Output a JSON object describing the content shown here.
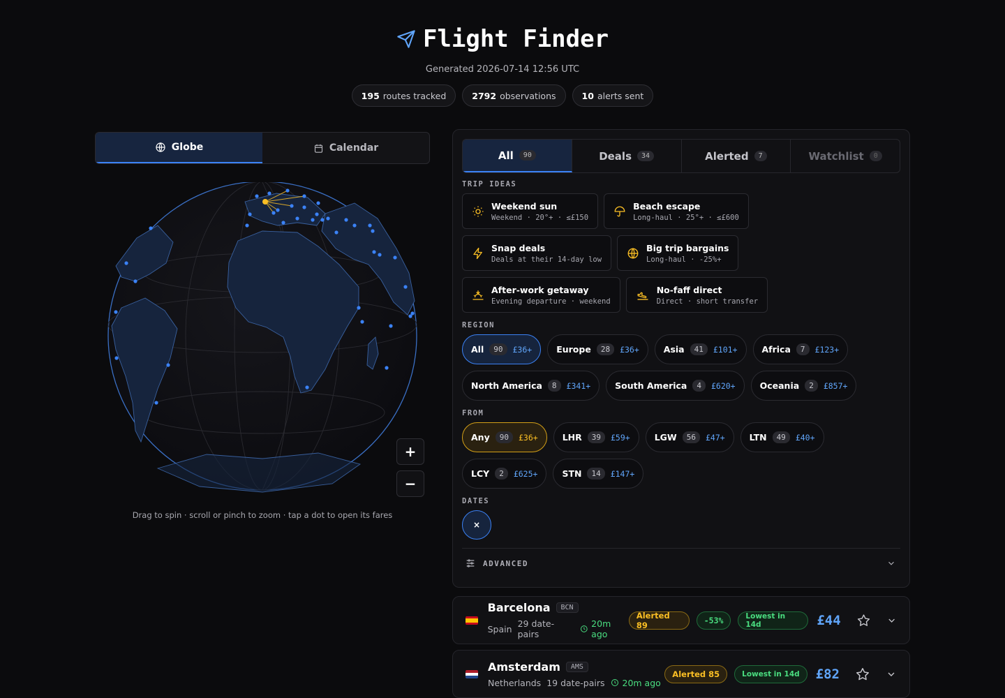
{
  "header": {
    "title": "Flight Finder",
    "generated": "Generated 2026-07-14 12:56 UTC",
    "stats": [
      {
        "value": "195",
        "label": "routes tracked"
      },
      {
        "value": "2792",
        "label": "observations"
      },
      {
        "value": "10",
        "label": "alerts sent"
      }
    ]
  },
  "left": {
    "tabs": [
      {
        "label": "Globe",
        "icon": "globe-icon"
      },
      {
        "label": "Calendar",
        "icon": "calendar-icon"
      }
    ],
    "zoom_in": "+",
    "zoom_out": "−",
    "hint": "Drag to spin · scroll or pinch to zoom · tap a dot to open its fares"
  },
  "filters": {
    "tabs": [
      {
        "label": "All",
        "count": "90"
      },
      {
        "label": "Deals",
        "count": "34"
      },
      {
        "label": "Alerted",
        "count": "7"
      },
      {
        "label": "Watchlist",
        "count": "0"
      }
    ],
    "trip_ideas_label": "TRIP IDEAS",
    "trip_ideas": [
      {
        "title": "Weekend sun",
        "sub": "Weekend · 20°+ · ≤£150",
        "icon": "sun-icon"
      },
      {
        "title": "Beach escape",
        "sub": "Long-haul · 25°+ · ≤£600",
        "icon": "umbrella-icon"
      },
      {
        "title": "Snap deals",
        "sub": "Deals at their 14-day low",
        "icon": "lightning-icon"
      },
      {
        "title": "Big trip bargains",
        "sub": "Long-haul · -25%+",
        "icon": "globe-icon"
      },
      {
        "title": "After-work getaway",
        "sub": "Evening departure · weekend",
        "icon": "sunset-icon"
      },
      {
        "title": "No-faff direct",
        "sub": "Direct · short transfer",
        "icon": "plane-landing-icon"
      }
    ],
    "region_label": "REGION",
    "regions": [
      {
        "name": "All",
        "count": "90",
        "price": "£36+"
      },
      {
        "name": "Europe",
        "count": "28",
        "price": "£36+"
      },
      {
        "name": "Asia",
        "count": "41",
        "price": "£101+"
      },
      {
        "name": "Africa",
        "count": "7",
        "price": "£123+"
      },
      {
        "name": "North America",
        "count": "8",
        "price": "£341+"
      },
      {
        "name": "South America",
        "count": "4",
        "price": "£620+"
      },
      {
        "name": "Oceania",
        "count": "2",
        "price": "£857+"
      }
    ],
    "from_label": "FROM",
    "airports": [
      {
        "name": "Any",
        "count": "90",
        "price": "£36+"
      },
      {
        "name": "LHR",
        "count": "39",
        "price": "£59+"
      },
      {
        "name": "LGW",
        "count": "56",
        "price": "£47+"
      },
      {
        "name": "LTN",
        "count": "49",
        "price": "£40+"
      },
      {
        "name": "LCY",
        "count": "2",
        "price": "£625+"
      },
      {
        "name": "STN",
        "count": "14",
        "price": "£147+"
      }
    ],
    "dates_label": "DATES",
    "dates_clear": "×",
    "advanced_label": "ADVANCED"
  },
  "results": [
    {
      "city": "Barcelona",
      "code": "BCN",
      "country": "Spain",
      "pairs": "29 date-pairs",
      "ago": "20m ago",
      "alerted": "Alerted 89",
      "pct": "-53%",
      "lowest": "Lowest in 14d",
      "price": "£44"
    },
    {
      "city": "Amsterdam",
      "code": "AMS",
      "country": "Netherlands",
      "pairs": "19 date-pairs",
      "ago": "20m ago",
      "alerted": "Alerted 85",
      "pct": "",
      "lowest": "Lowest in 14d",
      "price": "£82"
    }
  ],
  "colors": {
    "accent": "#3b82f6",
    "amber": "#fbbf24",
    "green": "#4ade80",
    "bg": "#0b0b0d"
  }
}
